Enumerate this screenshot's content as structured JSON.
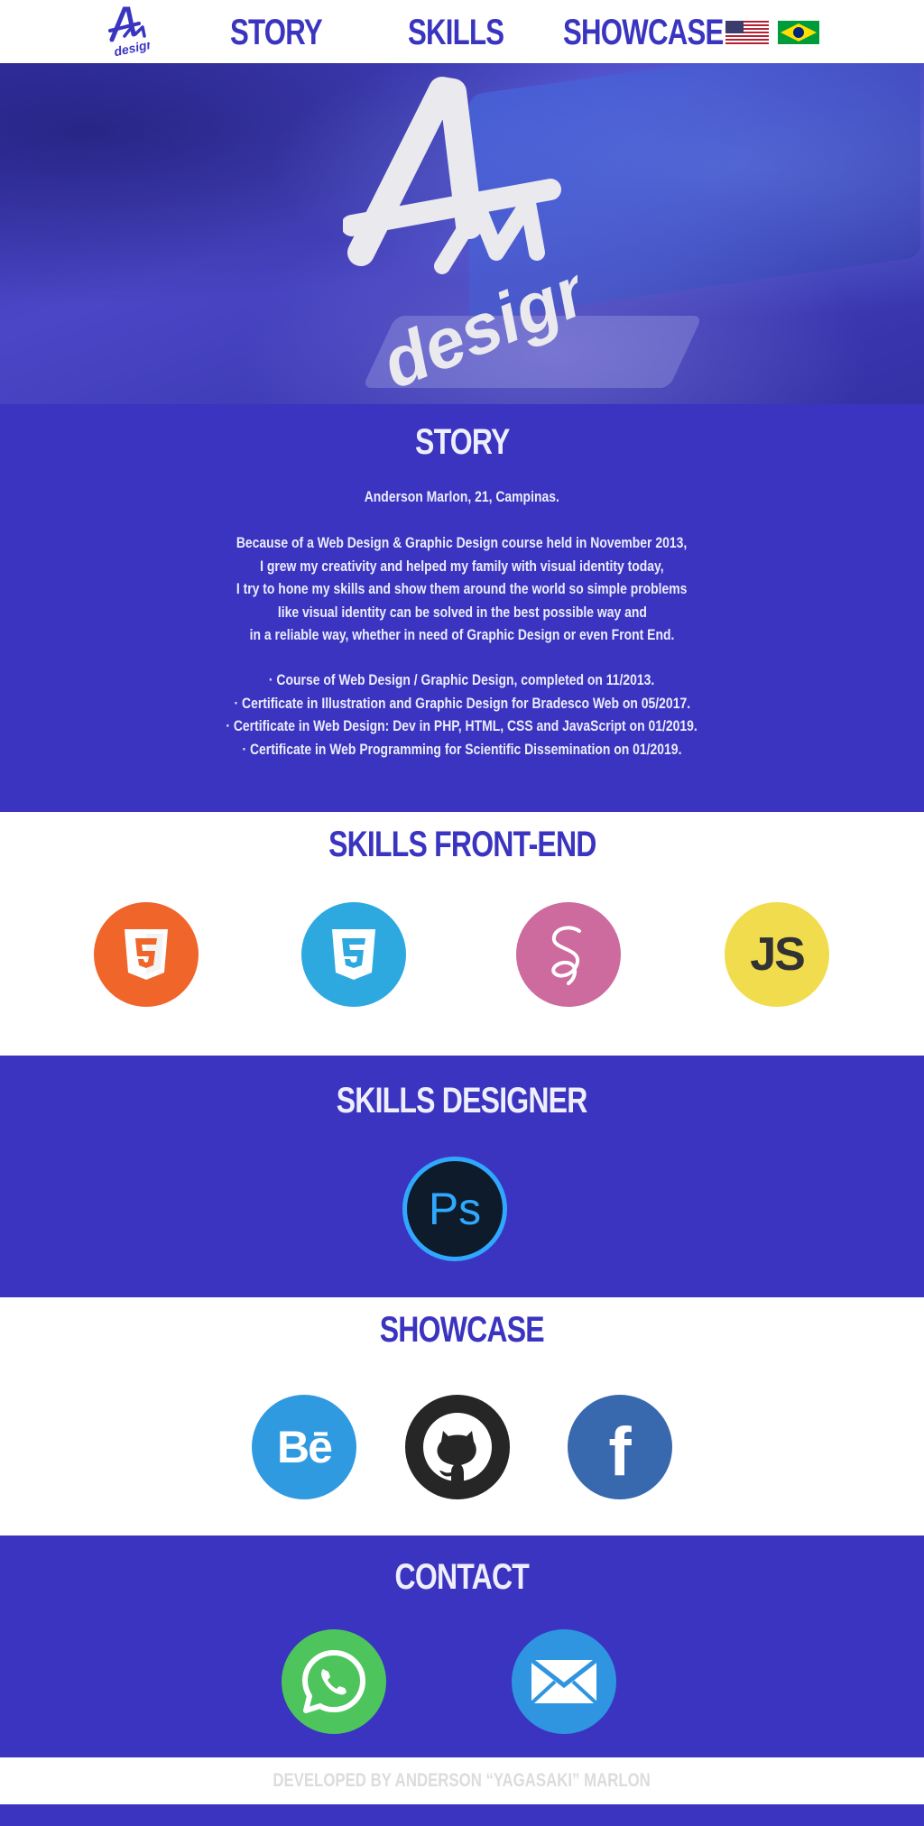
{
  "nav": {
    "logo_alt": "AM design",
    "links": [
      {
        "label": "STORY"
      },
      {
        "label": "SKILLS"
      },
      {
        "label": "SHOWCASE"
      }
    ],
    "flags": [
      {
        "icon": "us-flag-icon"
      },
      {
        "icon": "brazil-flag-icon"
      }
    ]
  },
  "hero": {
    "logo_text": "design"
  },
  "story": {
    "title": "STORY",
    "intro": "Anderson Marlon, 21, Campinas.",
    "paragraph": [
      "Because of a Web Design & Graphic Design course held in November 2013,",
      "I grew my creativity and helped my family with visual identity today,",
      "I try to hone my skills and show them around the world so simple problems",
      "like visual identity can be solved in the best possible way and",
      "in a reliable way, whether in need of Graphic Design or even Front End."
    ],
    "certificates": [
      "· Course of Web Design / Graphic Design, completed on 11/2013.",
      "· Certificate in Illustration and Graphic Design for Bradesco Web on 05/2017.",
      "· Certificate in Web Design: Dev in PHP, HTML, CSS and JavaScript on 01/2019.",
      "· Certificate in Web Programming for Scientific Dissemination on 01/2019."
    ]
  },
  "skills_frontend": {
    "title": "SKILLS FRONT-END",
    "items": [
      {
        "icon": "html5-icon",
        "color": "#f0652a"
      },
      {
        "icon": "css3-icon",
        "color": "#2ea9e0"
      },
      {
        "icon": "sass-icon",
        "color": "#cd6b9f"
      },
      {
        "icon": "javascript-icon",
        "color": "#f1dc4e",
        "text": "JS"
      }
    ]
  },
  "skills_designer": {
    "title": "SKILLS DESIGNER",
    "items": [
      {
        "icon": "photoshop-icon",
        "text": "Ps",
        "color": "#0d1b2a",
        "accent": "#31a8ff"
      }
    ]
  },
  "showcase": {
    "title": "SHOWCASE",
    "items": [
      {
        "icon": "behance-icon",
        "text": "Bē",
        "color": "#2f9ae0"
      },
      {
        "icon": "github-icon",
        "color": "#262626"
      },
      {
        "icon": "facebook-icon",
        "text": "f",
        "color": "#3868ae"
      }
    ]
  },
  "contact": {
    "title": "CONTACT",
    "items": [
      {
        "icon": "whatsapp-icon",
        "color": "#4ec45c"
      },
      {
        "icon": "email-icon",
        "color": "#2f95e0"
      }
    ]
  },
  "footer": {
    "text": "DEVELOPED BY ANDERSON “YAGASAKI” MARLON"
  },
  "colors": {
    "primary": "#3a34c0",
    "white": "#ffffff"
  }
}
